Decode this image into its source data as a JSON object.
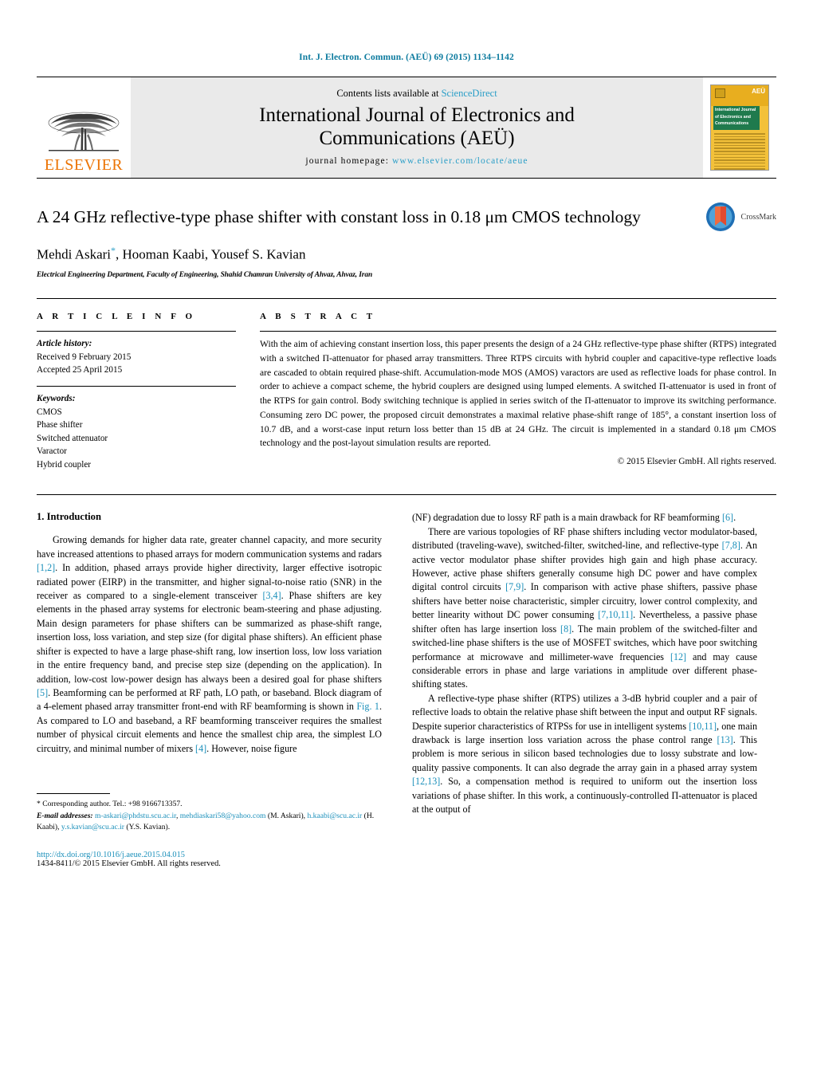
{
  "running_head": "Int. J. Electron. Commun. (AEÜ) 69 (2015) 1134–1142",
  "masthead": {
    "publisher": "ELSEVIER",
    "contents_prefix": "Contents lists available at ",
    "contents_link": "ScienceDirect",
    "journal_title_line1": "International Journal of Electronics and",
    "journal_title_line2": "Communications (AEÜ)",
    "homepage_label": "journal homepage:",
    "homepage_url": "www.elsevier.com/locate/aeue",
    "cover_line1": "International Journal",
    "cover_line2": "of Electronics and",
    "cover_line3": "Communications",
    "cover_mark": "AEÜ"
  },
  "article": {
    "title": "A 24 GHz reflective-type phase shifter with constant loss in 0.18 μm CMOS technology",
    "authors": "Mehdi Askari",
    "authors_rest": ", Hooman Kaabi, Yousef S. Kavian",
    "corresponding_marker": "*",
    "affiliation": "Electrical Engineering Department, Faculty of Engineering, Shahid Chamran University of Ahvaz, Ahvaz, Iran",
    "crossmark_label": "CrossMark"
  },
  "info": {
    "heading": "A R T I C L E   I N F O",
    "history_label": "Article history:",
    "history": [
      "Received 9 February 2015",
      "Accepted 25 April 2015"
    ],
    "keywords_label": "Keywords:",
    "keywords": [
      "CMOS",
      "Phase shifter",
      "Switched attenuator",
      "Varactor",
      "Hybrid coupler"
    ]
  },
  "abstract": {
    "heading": "A B S T R A C T",
    "text": "With the aim of achieving constant insertion loss, this paper presents the design of a 24 GHz reflective-type phase shifter (RTPS) integrated with a switched Π-attenuator for phased array transmitters. Three RTPS circuits with hybrid coupler and capacitive-type reflective loads are cascaded to obtain required phase-shift. Accumulation-mode MOS (AMOS) varactors are used as reflective loads for phase control. In order to achieve a compact scheme, the hybrid couplers are designed using lumped elements. A switched Π-attenuator is used in front of the RTPS for gain control. Body switching technique is applied in series switch of the Π-attenuator to improve its switching performance. Consuming zero DC power, the proposed circuit demonstrates a maximal relative phase-shift range of 185°, a constant insertion loss of 10.7 dB, and a worst-case input return loss better than 15 dB at 24 GHz. The circuit is implemented in a standard 0.18 μm CMOS technology and the post-layout simulation results are reported.",
    "copyright": "© 2015 Elsevier GmbH. All rights reserved."
  },
  "body": {
    "section_title": "1.  Introduction",
    "left_paragraph_1_a": "Growing demands for higher data rate, greater channel capacity, and more security have increased attentions to phased arrays for modern communication systems and radars ",
    "ref_1_2": "[1,2]",
    "left_paragraph_1_b": ". In addition, phased arrays provide higher directivity, larger effective isotropic radiated power (EIRP) in the transmitter, and higher signal-to-noise ratio (SNR) in the receiver as compared to a single-element transceiver ",
    "ref_3_4": "[3,4]",
    "left_paragraph_1_c": ". Phase shifters are key elements in the phased array systems for electronic beam-steering and phase adjusting. Main design parameters for phase shifters can be summarized as phase-shift range, insertion loss, loss variation, and step size (for digital phase shifters). An efficient phase shifter is expected to have a large phase-shift rang, low insertion loss, low loss variation in the entire frequency band, and precise step size (depending on the application). In addition, low-cost low-power design has always been a desired goal for phase shifters ",
    "ref_5": "[5]",
    "left_paragraph_1_d": ". Beamforming can be performed at RF path, LO path, or baseband. Block diagram of a 4-element phased array transmitter front-end with RF beamforming is shown in ",
    "ref_fig1": "Fig. 1",
    "left_paragraph_1_e": ". As compared to LO and baseband, a RF beamforming transceiver requires the smallest number of physical circuit elements and hence the smallest chip area, the simplest LO circuitry, and minimal number of mixers ",
    "ref_4": "[4]",
    "left_paragraph_1_f": ". However, noise figure",
    "right_paragraph_1_a": "(NF) degradation due to lossy RF path is a main drawback for RF beamforming ",
    "ref_6": "[6]",
    "right_paragraph_1_b": ".",
    "right_paragraph_2_a": "There are various topologies of RF phase shifters including vector modulator-based, distributed (traveling-wave), switched-filter, switched-line, and reflective-type ",
    "ref_7_8": "[7,8]",
    "right_paragraph_2_b": ". An active vector modulator phase shifter provides high gain and high phase accuracy. However, active phase shifters generally consume high DC power and have complex digital control circuits ",
    "ref_7_9": "[7,9]",
    "right_paragraph_2_c": ". In comparison with active phase shifters, passive phase shifters have better noise characteristic, simpler circuitry, lower control complexity, and better linearity without DC power consuming ",
    "ref_7_10_11": "[7,10,11]",
    "right_paragraph_2_d": ". Nevertheless, a passive phase shifter often has large insertion loss ",
    "ref_8": "[8]",
    "right_paragraph_2_e": ". The main problem of the switched-filter and switched-line phase shifters is the use of MOSFET switches, which have poor switching performance at microwave and millimeter-wave frequencies ",
    "ref_12": "[12]",
    "right_paragraph_2_f": " and may cause considerable errors in phase and large variations in amplitude over different phase-shifting states.",
    "right_paragraph_3_a": "A reflective-type phase shifter (RTPS) utilizes a 3-dB hybrid coupler and a pair of reflective loads to obtain the relative phase shift between the input and output RF signals. Despite superior characteristics of RTPSs for use in intelligent systems ",
    "ref_10_11": "[10,11]",
    "right_paragraph_3_b": ", one main drawback is large insertion loss variation across the phase control range ",
    "ref_13": "[13]",
    "right_paragraph_3_c": ". This problem is more serious in silicon based technologies due to lossy substrate and low-quality passive components. It can also degrade the array gain in a phased array system ",
    "ref_12_13": "[12,13]",
    "right_paragraph_3_d": ". So, a compensation method is required to uniform out the insertion loss variations of phase shifter. In this work, a continuously-controlled Π-attenuator is placed at the output of"
  },
  "footnotes": {
    "corresponding": "* Corresponding author. Tel.: +98 9166713357.",
    "email_label": "E-mail addresses:",
    "email_1": "m-askari@phdstu.scu.ac.ir",
    "email_2": "mehdiaskari58@yahoo.com",
    "email_1_owner": "(M. Askari),",
    "email_3": "h.kaabi@scu.ac.ir",
    "email_3_owner": "(H. Kaabi),",
    "email_4": "y.s.kavian@scu.ac.ir",
    "email_4_owner": "(Y.S. Kavian).",
    "doi": "http://dx.doi.org/10.1016/j.aeue.2015.04.015",
    "issn": "1434-8411/© 2015 Elsevier GmbH. All rights reserved."
  },
  "colors": {
    "link": "#1a8fba",
    "elsevier_orange": "#ec7404",
    "science_direct": "#2a9ec7"
  }
}
